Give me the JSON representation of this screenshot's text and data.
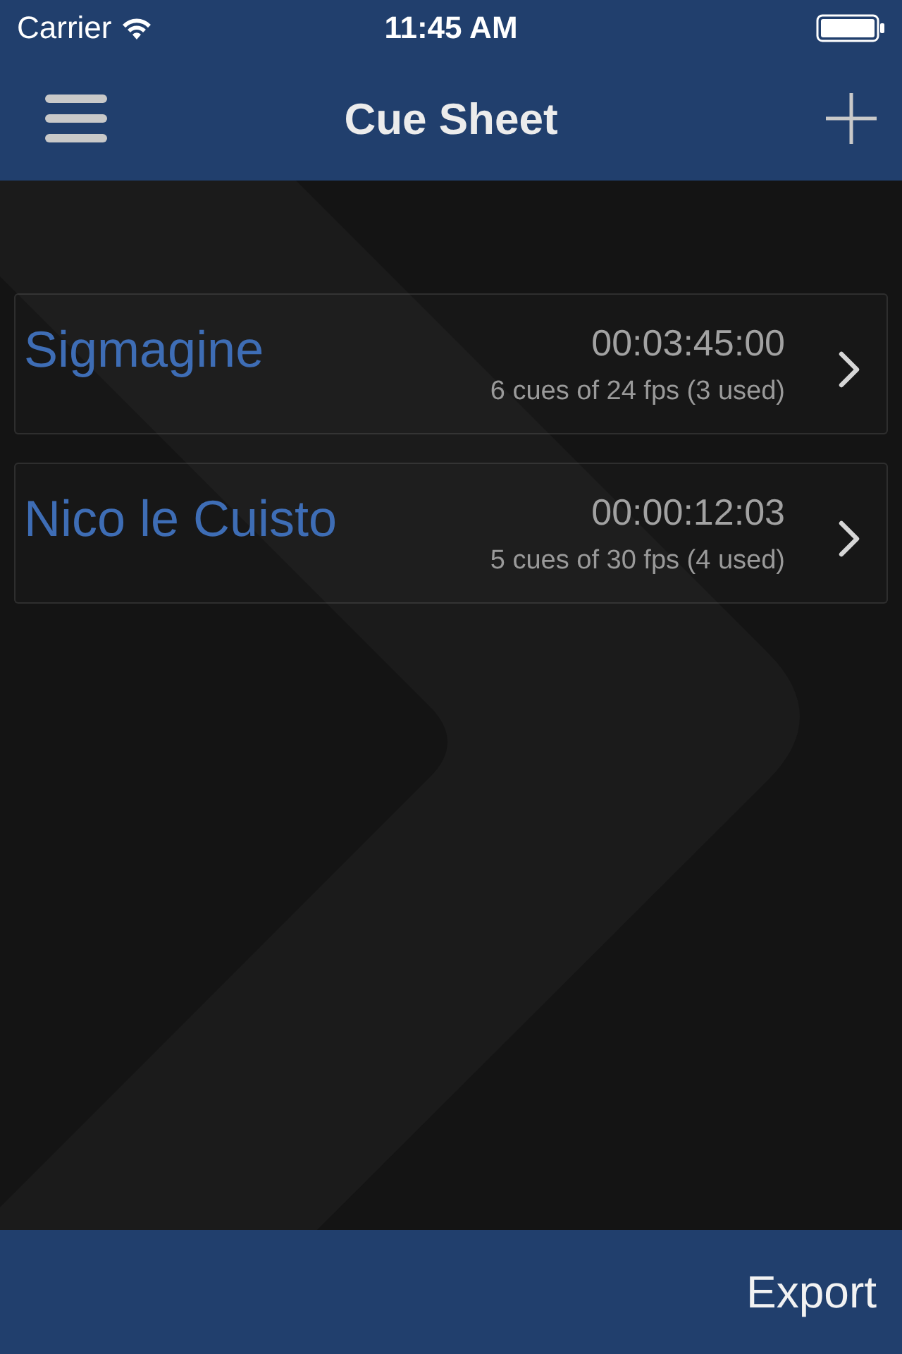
{
  "status_bar": {
    "carrier": "Carrier",
    "time": "11:45 AM"
  },
  "nav_bar": {
    "title": "Cue Sheet"
  },
  "cue_sheets": [
    {
      "name": "Sigmagine",
      "duration": "00:03:45:00",
      "summary": "6 cues of 24 fps (3 used)"
    },
    {
      "name": "Nico le Cuisto",
      "duration": "00:00:12:03",
      "summary": "5 cues of 30 fps (4 used)"
    }
  ],
  "toolbar": {
    "buttons": [
      "Export"
    ]
  }
}
